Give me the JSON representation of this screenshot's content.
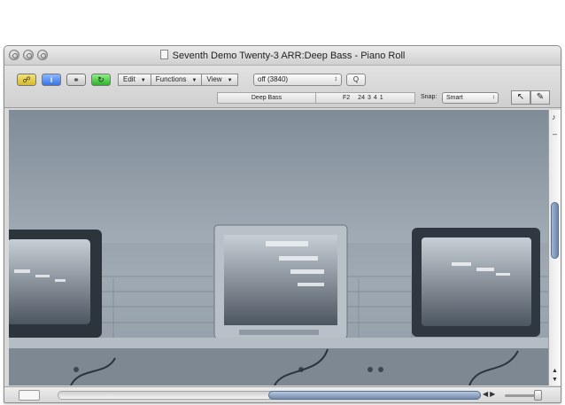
{
  "window": {
    "title": "Seventh Demo Twenty-3 ARR:Deep Bass - Piano Roll"
  },
  "toolbar": {
    "buttons": [
      {
        "name": "link-icon",
        "color": "#e3c84a"
      },
      {
        "label": "i",
        "name": "info-icon",
        "color": "#4a86ee"
      },
      {
        "name": "headphones-icon",
        "color": "#d8d8d8"
      },
      {
        "name": "loop-icon",
        "color": "#4cc646"
      }
    ],
    "menus": [
      {
        "label": "Edit"
      },
      {
        "label": "Functions"
      },
      {
        "label": "View"
      }
    ],
    "link_select": {
      "value": "off (3840)"
    },
    "q_button": {
      "label": "Q"
    }
  },
  "infobar": {
    "region_name": "Deep Bass",
    "note": "F2",
    "position": [
      "24",
      "3",
      "4",
      "1"
    ],
    "snap_label": "Snap:",
    "snap_value": "Smart"
  },
  "tools": {
    "left_tool": "pointer-icon",
    "right_tool": "pencil-icon"
  },
  "editor": {
    "content": "photo of three CRT television monitors on a shelf",
    "tint": "#8f9aa4"
  }
}
